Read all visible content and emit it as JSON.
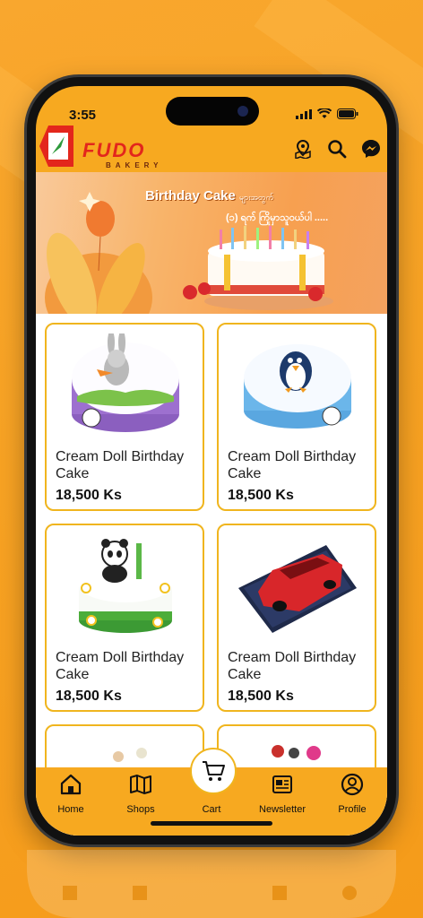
{
  "status": {
    "time": "3:55"
  },
  "brand": {
    "name": "FUDO",
    "sub": "BAKERY"
  },
  "banner": {
    "title": "Birthday Cake",
    "title_suffix": "များအတွက်",
    "subtitle": "(၁) ရက် ကြိုမှာသူဝယ်ပါ ....."
  },
  "products": [
    {
      "name": "Cream Doll Birthday Cake",
      "price": "18,500 Ks",
      "image": "bunny-cake"
    },
    {
      "name": "Cream Doll Birthday Cake",
      "price": "18,500 Ks",
      "image": "penguin-cake"
    },
    {
      "name": "Cream Doll Birthday Cake",
      "price": "18,500 Ks",
      "image": "panda-cake"
    },
    {
      "name": "Cream Doll Birthday Cake",
      "price": "18,500 Ks",
      "image": "car-cake"
    }
  ],
  "nav": {
    "home": "Home",
    "shops": "Shops",
    "cart": "Cart",
    "newsletter": "Newsletter",
    "profile": "Profile"
  },
  "colors": {
    "accent": "#f7a920",
    "card_border": "#f0b51e",
    "brand_red": "#e3261c"
  }
}
